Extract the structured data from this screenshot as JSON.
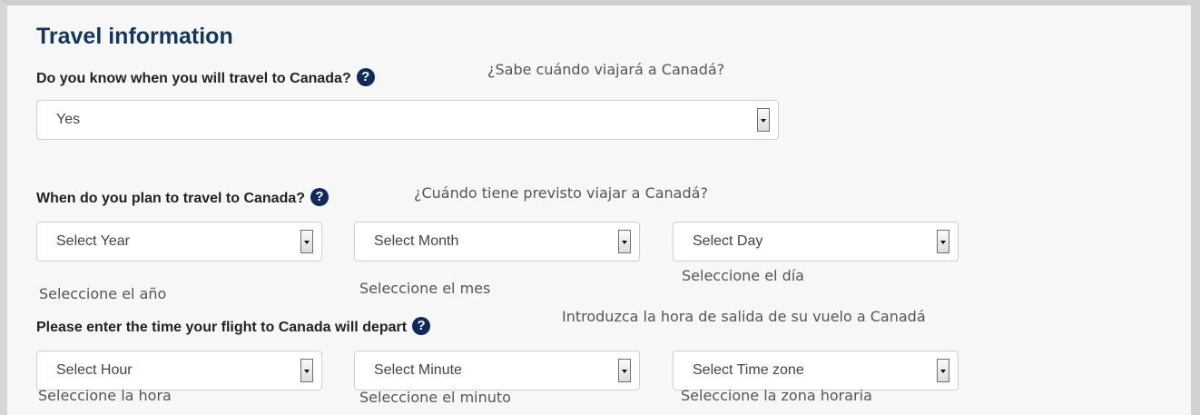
{
  "section": {
    "title": "Travel information"
  },
  "q_know": {
    "label": "Do you know when you will travel to Canada?",
    "help_icon": "question-circle-icon",
    "help_glyph": "?",
    "translation": "¿Sabe cuándo viajará a Canadá?",
    "select_value": "Yes"
  },
  "q_when": {
    "label": "When do you plan to travel to Canada?",
    "help_glyph": "?",
    "translation": "¿Cuándo tiene previsto viajar a Canadá?",
    "year": {
      "value": "Select Year",
      "translation": "Seleccione el año"
    },
    "month": {
      "value": "Select Month",
      "translation": "Seleccione el mes"
    },
    "day": {
      "value": "Select Day",
      "translation": "Seleccione el día"
    }
  },
  "q_time": {
    "label": "Please enter the time your flight to Canada will depart",
    "help_glyph": "?",
    "translation": "Introduzca la hora de salida de su vuelo a Canadá",
    "hour": {
      "value": "Select Hour",
      "translation": "Seleccione la hora"
    },
    "minute": {
      "value": "Select Minute",
      "translation": "Seleccione el minuto"
    },
    "timezone": {
      "value": "Select Time zone",
      "translation": "Seleccione la zona horaria"
    }
  },
  "colors": {
    "title": "#13365c",
    "help_icon_bg": "#0f2a5a",
    "panel_bg": "#f7f7f7"
  }
}
